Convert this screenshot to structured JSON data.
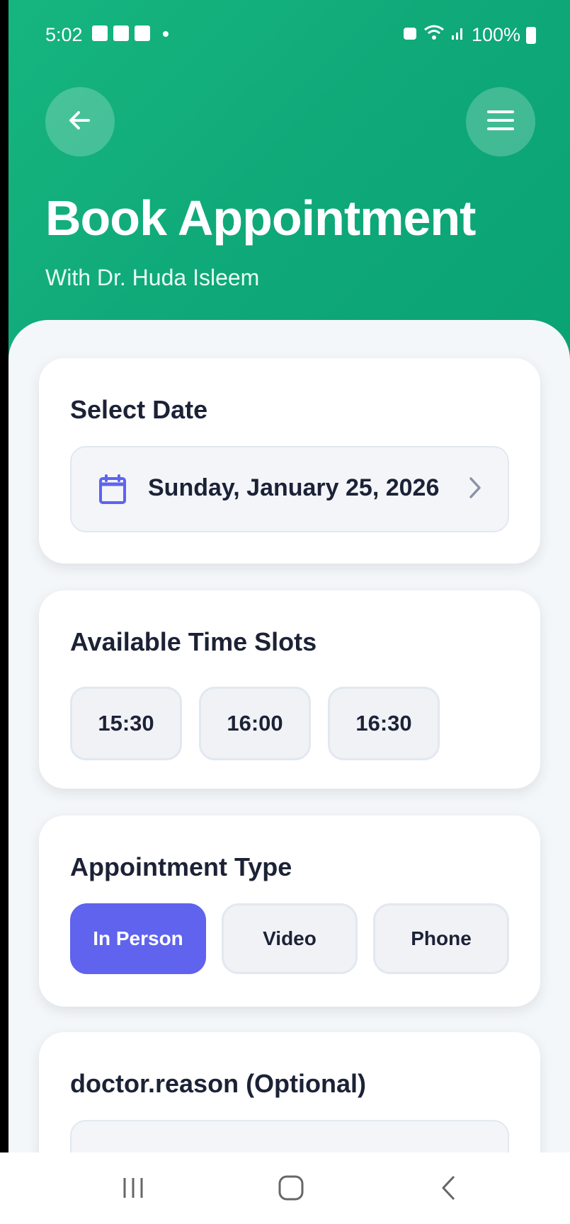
{
  "status_bar": {
    "time": "5:02",
    "battery": "100%",
    "icons_left": [
      "gallery-icon",
      "device-icon",
      "check-icon",
      "dot-icon"
    ],
    "icons_right": [
      "alarm-icon",
      "wifi-icon",
      "signal-icon",
      "battery-icon"
    ]
  },
  "header": {
    "title": "Book Appointment",
    "subtitle": "With Dr. Huda Isleem"
  },
  "date_card": {
    "title": "Select Date",
    "selected_date": "Sunday, January 25, 2026"
  },
  "slots_card": {
    "title": "Available Time Slots",
    "slots": [
      "15:30",
      "16:00",
      "16:30"
    ]
  },
  "type_card": {
    "title": "Appointment Type",
    "options": [
      "In Person",
      "Video",
      "Phone"
    ],
    "selected": "In Person"
  },
  "reason_card": {
    "title": "doctor.reason (Optional)"
  },
  "colors": {
    "header_green": "#12ae7b",
    "accent_purple": "#5f63ee",
    "text_dark": "#1c2236"
  }
}
